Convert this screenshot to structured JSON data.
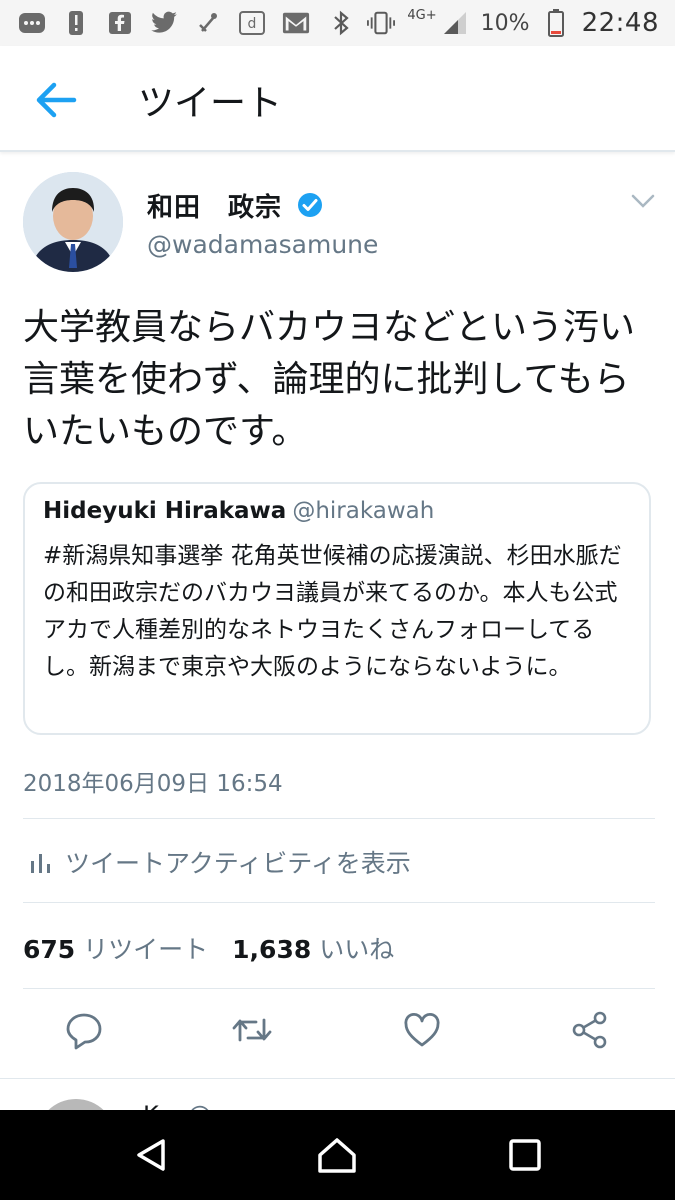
{
  "status_bar": {
    "network": "4G+",
    "battery": "10%",
    "time": "22:48",
    "left_icons": [
      "notification-dot-icon",
      "alert-icon",
      "facebook-icon",
      "twitter-icon",
      "music-icon",
      "d-app-icon",
      "gmail-icon"
    ],
    "right_icons": [
      "bluetooth-icon",
      "vibrate-icon",
      "signal-icon",
      "battery-icon"
    ]
  },
  "header": {
    "title": "ツイート"
  },
  "tweet": {
    "author_name": "和田　政宗",
    "author_handle": "@wadamasamune",
    "verified": true,
    "text": "大学教員ならバカウヨなどという汚い言葉を使わず、論理的に批判してもらいたいものです。",
    "quoted": {
      "name": "Hideyuki Hirakawa",
      "handle": "@hirakawah",
      "text": "#新潟県知事選挙 花角英世候補の応援演説、杉田水脈だの和田政宗だのバカウヨ議員が来てるのか。本人も公式アカで人種差別的なネトウヨたくさんフォローしてるし。新潟まで東京や大阪のようにならないように。"
    },
    "timestamp": "2018年06月09日 16:54",
    "activity_label": "ツイートアクティビティを表示",
    "retweets_count": "675",
    "retweets_label": "リツイート",
    "likes_count": "1,638",
    "likes_label": "いいね"
  },
  "next_reply_peek": {
    "name": "K...",
    "handle": "@..."
  },
  "colors": {
    "accent": "#1da1f2",
    "text": "#14171a",
    "secondary": "#657786",
    "border": "#e1e8ed"
  }
}
